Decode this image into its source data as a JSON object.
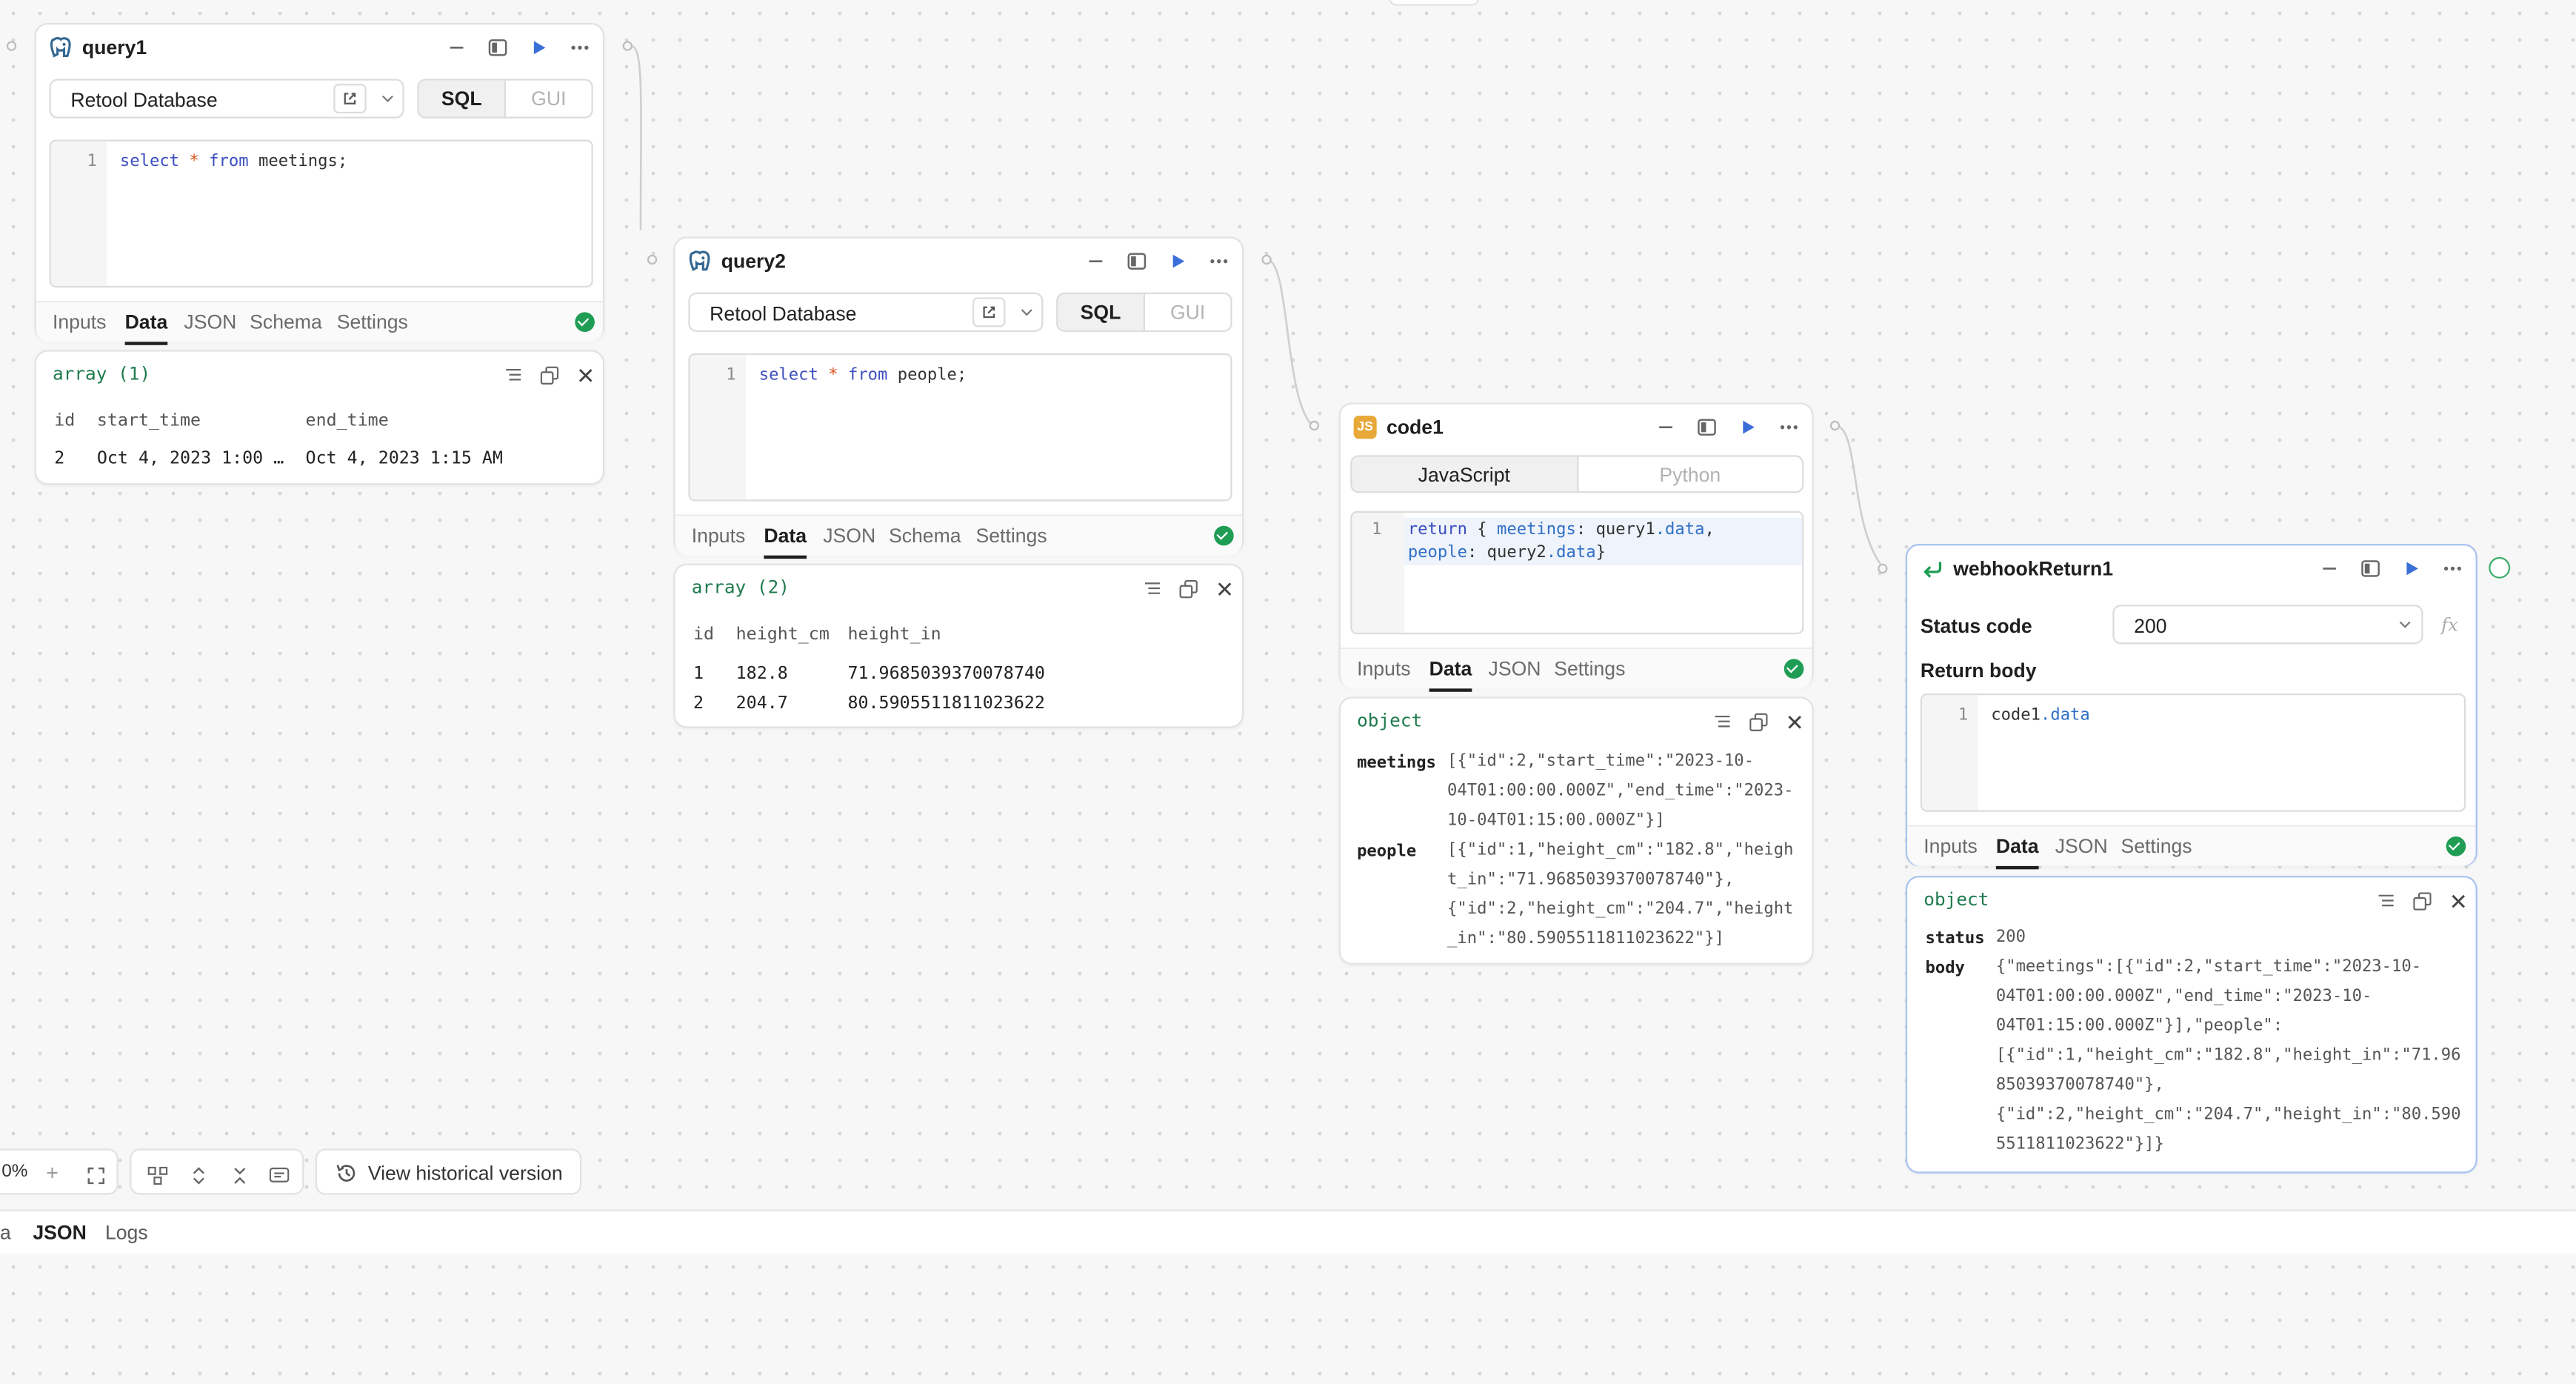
{
  "query1": {
    "title": "query1",
    "resource": "Retool Database",
    "mode_options": [
      "SQL",
      "GUI"
    ],
    "line_number": "1",
    "code": {
      "kw1": "select",
      "star": "*",
      "kw2": "from",
      "rest": "meetings;"
    },
    "tabs": [
      "Inputs",
      "Data",
      "JSON",
      "Schema",
      "Settings"
    ],
    "active_tab": "Data",
    "result": {
      "label": "array (1)",
      "columns": [
        "id",
        "start_time",
        "end_time"
      ],
      "rows": [
        [
          "2",
          "Oct 4, 2023 1:00 …",
          "Oct 4, 2023 1:15 AM"
        ]
      ]
    }
  },
  "query2": {
    "title": "query2",
    "resource": "Retool Database",
    "mode_options": [
      "SQL",
      "GUI"
    ],
    "line_number": "1",
    "code": {
      "kw1": "select",
      "star": "*",
      "kw2": "from",
      "rest": "people;"
    },
    "tabs": [
      "Inputs",
      "Data",
      "JSON",
      "Schema",
      "Settings"
    ],
    "active_tab": "Data",
    "result": {
      "label": "array (2)",
      "columns": [
        "id",
        "height_cm",
        "height_in"
      ],
      "rows": [
        [
          "1",
          "182.8",
          "71.9685039370078740"
        ],
        [
          "2",
          "204.7",
          "80.5905511811023622"
        ]
      ]
    }
  },
  "code1": {
    "title": "code1",
    "icon_text": "JS",
    "languages": [
      "JavaScript",
      "Python"
    ],
    "line_number": "1",
    "code": {
      "kw": "return",
      "l1a": " { ",
      "k1": "meetings",
      "l1b": ": query1",
      "p1": ".data",
      "l1c": ",",
      "k2": "people",
      "l2b": ": query2",
      "p2": ".data",
      "l2c": "}"
    },
    "tabs": [
      "Inputs",
      "Data",
      "JSON",
      "Settings"
    ],
    "active_tab": "Data",
    "result": {
      "label": "object",
      "entries": [
        {
          "key": "meetings",
          "lines": [
            "[{\"id\":2,\"start_time\":\"2023-10-",
            "04T01:00:00.000Z\",\"end_time\":\"2023-",
            "10-04T01:15:00.000Z\"}]"
          ]
        },
        {
          "key": "people",
          "lines": [
            "[{\"id\":1,\"height_cm\":\"182.8\",\"heigh",
            "t_in\":\"71.9685039370078740\"},",
            "{\"id\":2,\"height_cm\":\"204.7\",\"height",
            "_in\":\"80.5905511811023622\"}]"
          ]
        }
      ]
    }
  },
  "webhookReturn1": {
    "title": "webhookReturn1",
    "status_code_label": "Status code",
    "status_code_value": "200",
    "fx_label": "fx",
    "return_body_label": "Return body",
    "line_number": "1",
    "code": {
      "a": "code1",
      "b": ".data"
    },
    "tabs": [
      "Inputs",
      "Data",
      "JSON",
      "Settings"
    ],
    "active_tab": "Data",
    "result": {
      "label": "object",
      "status_key": "status",
      "status_value": "200",
      "body_key": "body",
      "body_lines": [
        "{\"meetings\":[{\"id\":2,\"start_time\":\"2023-10-",
        "04T01:00:00.000Z\",\"end_time\":\"2023-10-",
        "04T01:15:00.000Z\"}],\"people\":",
        "[{\"id\":1,\"height_cm\":\"182.8\",\"height_in\":\"71.96",
        "85039370078740\"},",
        "{\"id\":2,\"height_cm\":\"204.7\",\"height_in\":\"80.590",
        "5511811023622\"}]}"
      ]
    }
  },
  "toolbar": {
    "zoom": "0%",
    "history_label": "View historical version"
  },
  "bottom_tabs": [
    "a",
    "JSON",
    "Logs"
  ],
  "active_bottom_tab": "JSON",
  "colors": {
    "accent": "#3b6fd8",
    "success": "#1f9d55",
    "selection": "#a7c2ef",
    "object_label": "#1f7a4d"
  }
}
